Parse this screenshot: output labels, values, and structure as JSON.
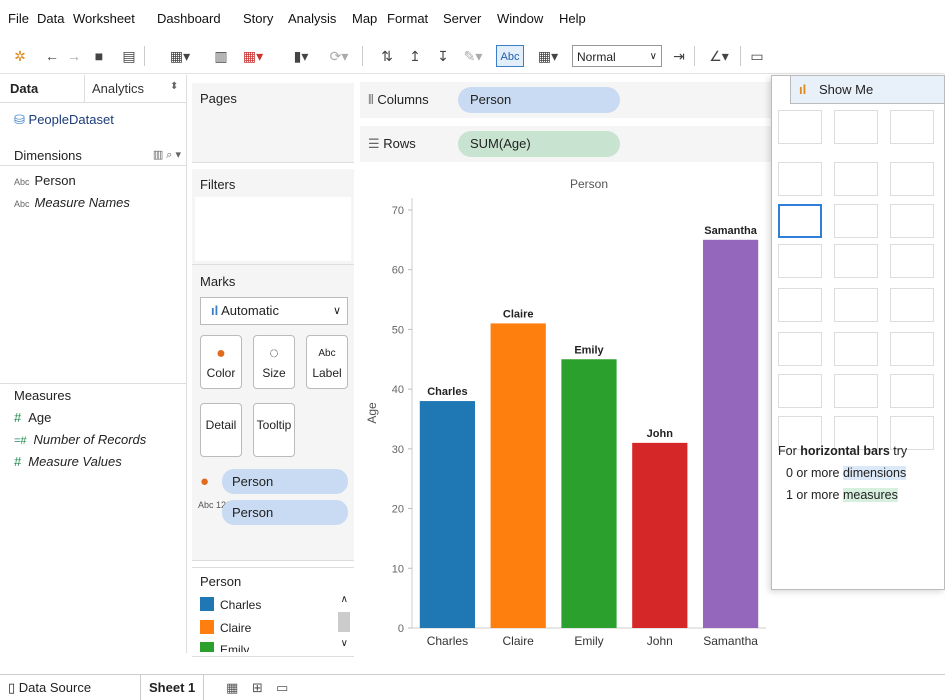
{
  "menu": [
    "File",
    "Data",
    "Worksheet",
    "Dashboard",
    "Story",
    "Analysis",
    "Map",
    "Format",
    "Server",
    "Window",
    "Help"
  ],
  "toolbar": {
    "abc_label": "Abc",
    "fit_value": "Normal"
  },
  "data_pane": {
    "tab_data": "Data",
    "tab_analytics": "Analytics",
    "datasource": "PeopleDataset",
    "dimensions_header": "Dimensions",
    "dimensions": [
      {
        "icon": "Abc",
        "label": "Person"
      },
      {
        "icon": "Abc",
        "label": "Measure Names"
      }
    ],
    "measures_header": "Measures",
    "measures": [
      {
        "icon": "#",
        "label": "Age"
      },
      {
        "icon": "=#",
        "label": "Number of Records"
      },
      {
        "icon": "#",
        "label": "Measure Values"
      }
    ]
  },
  "pages": {
    "title": "Pages"
  },
  "filters": {
    "title": "Filters"
  },
  "marks": {
    "title": "Marks",
    "type": "Automatic",
    "buttons": [
      "Color",
      "Size",
      "Label",
      "Detail",
      "Tooltip"
    ],
    "pills": [
      {
        "icon": "color",
        "label": "Person"
      },
      {
        "icon": "Abc 123",
        "label": "Person"
      }
    ]
  },
  "legend": {
    "title": "Person",
    "items": [
      {
        "label": "Charles",
        "color": "#1f77b4"
      },
      {
        "label": "Claire",
        "color": "#ff7f0e"
      },
      {
        "label": "Emily",
        "color": "#2ca02c"
      }
    ]
  },
  "shelves": {
    "columns_label": "Columns",
    "columns_pill": "Person",
    "rows_label": "Rows",
    "rows_pill": "SUM(Age)"
  },
  "chart_data": {
    "type": "bar",
    "title": "Person",
    "ylabel": "Age",
    "categories": [
      "Charles",
      "Claire",
      "Emily",
      "John",
      "Samantha"
    ],
    "values": [
      38,
      51,
      45,
      31,
      65
    ],
    "colors": [
      "#1f77b4",
      "#ff7f0e",
      "#2ca02c",
      "#d62728",
      "#9467bd"
    ],
    "yticks": [
      0,
      10,
      20,
      30,
      40,
      50,
      60,
      70
    ],
    "ylim": [
      0,
      72
    ],
    "data_labels": true,
    "grid": false
  },
  "show_me": {
    "title": "Show Me",
    "hint_prefix": "For ",
    "hint_bold": "horizontal bars",
    "hint_suffix": " try",
    "req1_num": "0 or more ",
    "req1_word": "dimensions",
    "req2_num": "1 or more ",
    "req2_word": "measures"
  },
  "bottom_tabs": {
    "datasource": "Data Source",
    "sheet": "Sheet 1"
  }
}
